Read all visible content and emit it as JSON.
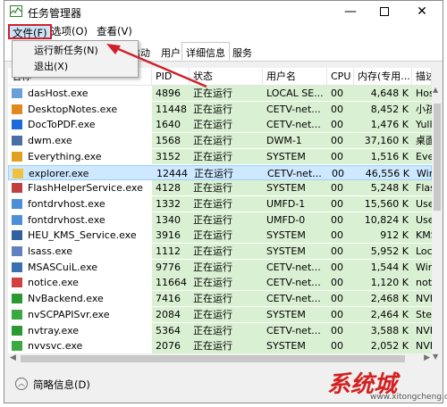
{
  "window": {
    "title": "任务管理器"
  },
  "menu": {
    "file": "文件(F)",
    "options": "选项(O)",
    "view": "查看(V)"
  },
  "file_menu": {
    "run_new_task": "运行新任务(N)",
    "exit": "退出(X)"
  },
  "tabs": {
    "startup": "启动",
    "users": "用户",
    "details": "详细信息",
    "services": "服务"
  },
  "columns": {
    "name": "名称",
    "pid": "PID",
    "status": "状态",
    "user": "用户名",
    "cpu": "CPU",
    "memory": "内存(专用...",
    "desc": "描述"
  },
  "rows": [
    {
      "name": "dasHost.exe",
      "pid": "4896",
      "status": "正在运行",
      "user": "LOCAL SE...",
      "cpu": "00",
      "mem": "4,648 K",
      "desc": "Host"
    },
    {
      "name": "DesktopNotes.exe",
      "pid": "11448",
      "status": "正在运行",
      "user": "CETV-net...",
      "cpu": "00",
      "mem": "8,452 K",
      "desc": "小孩"
    },
    {
      "name": "DocToPDF.exe",
      "pid": "1640",
      "status": "正在运行",
      "user": "CETV-net...",
      "cpu": "00",
      "mem": "1,476 K",
      "desc": "Yull"
    },
    {
      "name": "dwm.exe",
      "pid": "1568",
      "status": "正在运行",
      "user": "DWM-1",
      "cpu": "00",
      "mem": "37,160 K",
      "desc": "桌面"
    },
    {
      "name": "Everything.exe",
      "pid": "3152",
      "status": "正在运行",
      "user": "SYSTEM",
      "cpu": "00",
      "mem": "1,516 K",
      "desc": "Eve"
    },
    {
      "name": "explorer.exe",
      "pid": "12444",
      "status": "正在运行",
      "user": "CETV-net...",
      "cpu": "00",
      "mem": "46,556 K",
      "desc": "Win"
    },
    {
      "name": "FlashHelperService.exe",
      "pid": "4128",
      "status": "正在运行",
      "user": "SYSTEM",
      "cpu": "00",
      "mem": "5,248 K",
      "desc": "Flas"
    },
    {
      "name": "fontdrvhost.exe",
      "pid": "1332",
      "status": "正在运行",
      "user": "UMFD-1",
      "cpu": "00",
      "mem": "15,560 K",
      "desc": "Use"
    },
    {
      "name": "fontdrvhost.exe",
      "pid": "1340",
      "status": "正在运行",
      "user": "UMFD-0",
      "cpu": "00",
      "mem": "10,824 K",
      "desc": "Use"
    },
    {
      "name": "HEU_KMS_Service.exe",
      "pid": "3916",
      "status": "正在运行",
      "user": "SYSTEM",
      "cpu": "00",
      "mem": "912 K",
      "desc": "KMS"
    },
    {
      "name": "lsass.exe",
      "pid": "1112",
      "status": "正在运行",
      "user": "SYSTEM",
      "cpu": "00",
      "mem": "5,952 K",
      "desc": "Loc"
    },
    {
      "name": "MSASCuiL.exe",
      "pid": "9776",
      "status": "正在运行",
      "user": "CETV-net...",
      "cpu": "00",
      "mem": "1,544 K",
      "desc": "Win"
    },
    {
      "name": "notice.exe",
      "pid": "11664",
      "status": "正在运行",
      "user": "CETV-net...",
      "cpu": "00",
      "mem": "1,120 K",
      "desc": "noti"
    },
    {
      "name": "NvBackend.exe",
      "pid": "7416",
      "status": "正在运行",
      "user": "CETV-net...",
      "cpu": "00",
      "mem": "2,468 K",
      "desc": "NVI"
    },
    {
      "name": "nvSCPAPISvr.exe",
      "pid": "2084",
      "status": "正在运行",
      "user": "SYSTEM",
      "cpu": "00",
      "mem": "2,464 K",
      "desc": "Ster"
    },
    {
      "name": "nvtray.exe",
      "pid": "5364",
      "status": "正在运行",
      "user": "CETV-net...",
      "cpu": "00",
      "mem": "3,588 K",
      "desc": "NVI"
    },
    {
      "name": "nvvsvc.exe",
      "pid": "2076",
      "status": "正在运行",
      "user": "SYSTEM",
      "cpu": "00",
      "mem": "2,052 K",
      "desc": "NVI"
    }
  ],
  "footer": {
    "fewer_details": "简略信息(D)"
  },
  "colors": {
    "selected_row": "#cde8ff",
    "running_bg": "#daf0d3",
    "highlight": "#d0202a"
  },
  "watermark": {
    "text": "系统城",
    "url": "www.xitongcheng.com"
  }
}
